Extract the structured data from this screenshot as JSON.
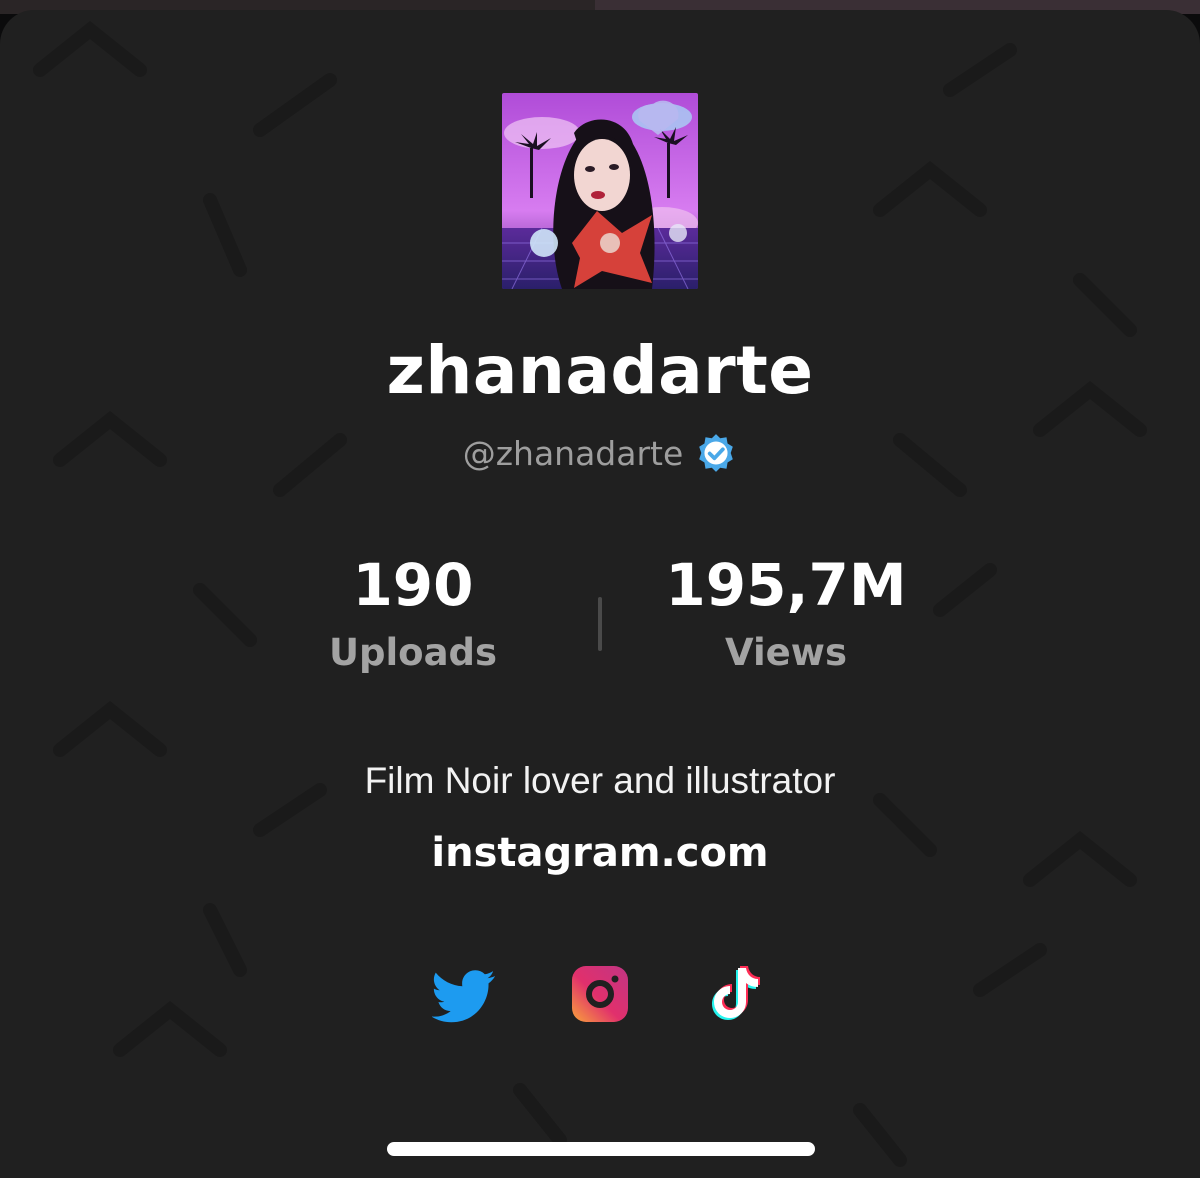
{
  "profile": {
    "display_name": "zhanadarte",
    "handle": "@zhanadarte",
    "verified": true,
    "bio": "Film Noir lover and illustrator",
    "link": "instagram.com"
  },
  "stats": {
    "uploads": {
      "value": "190",
      "label": "Uploads"
    },
    "views": {
      "value": "195,7M",
      "label": "Views"
    }
  },
  "socials": [
    {
      "name": "twitter-icon"
    },
    {
      "name": "instagram-icon"
    },
    {
      "name": "tiktok-icon"
    }
  ],
  "colors": {
    "background": "#202020",
    "verified_badge": "#4aa8e8",
    "twitter": "#1d9bf0",
    "muted_text": "#9e9e9e"
  }
}
